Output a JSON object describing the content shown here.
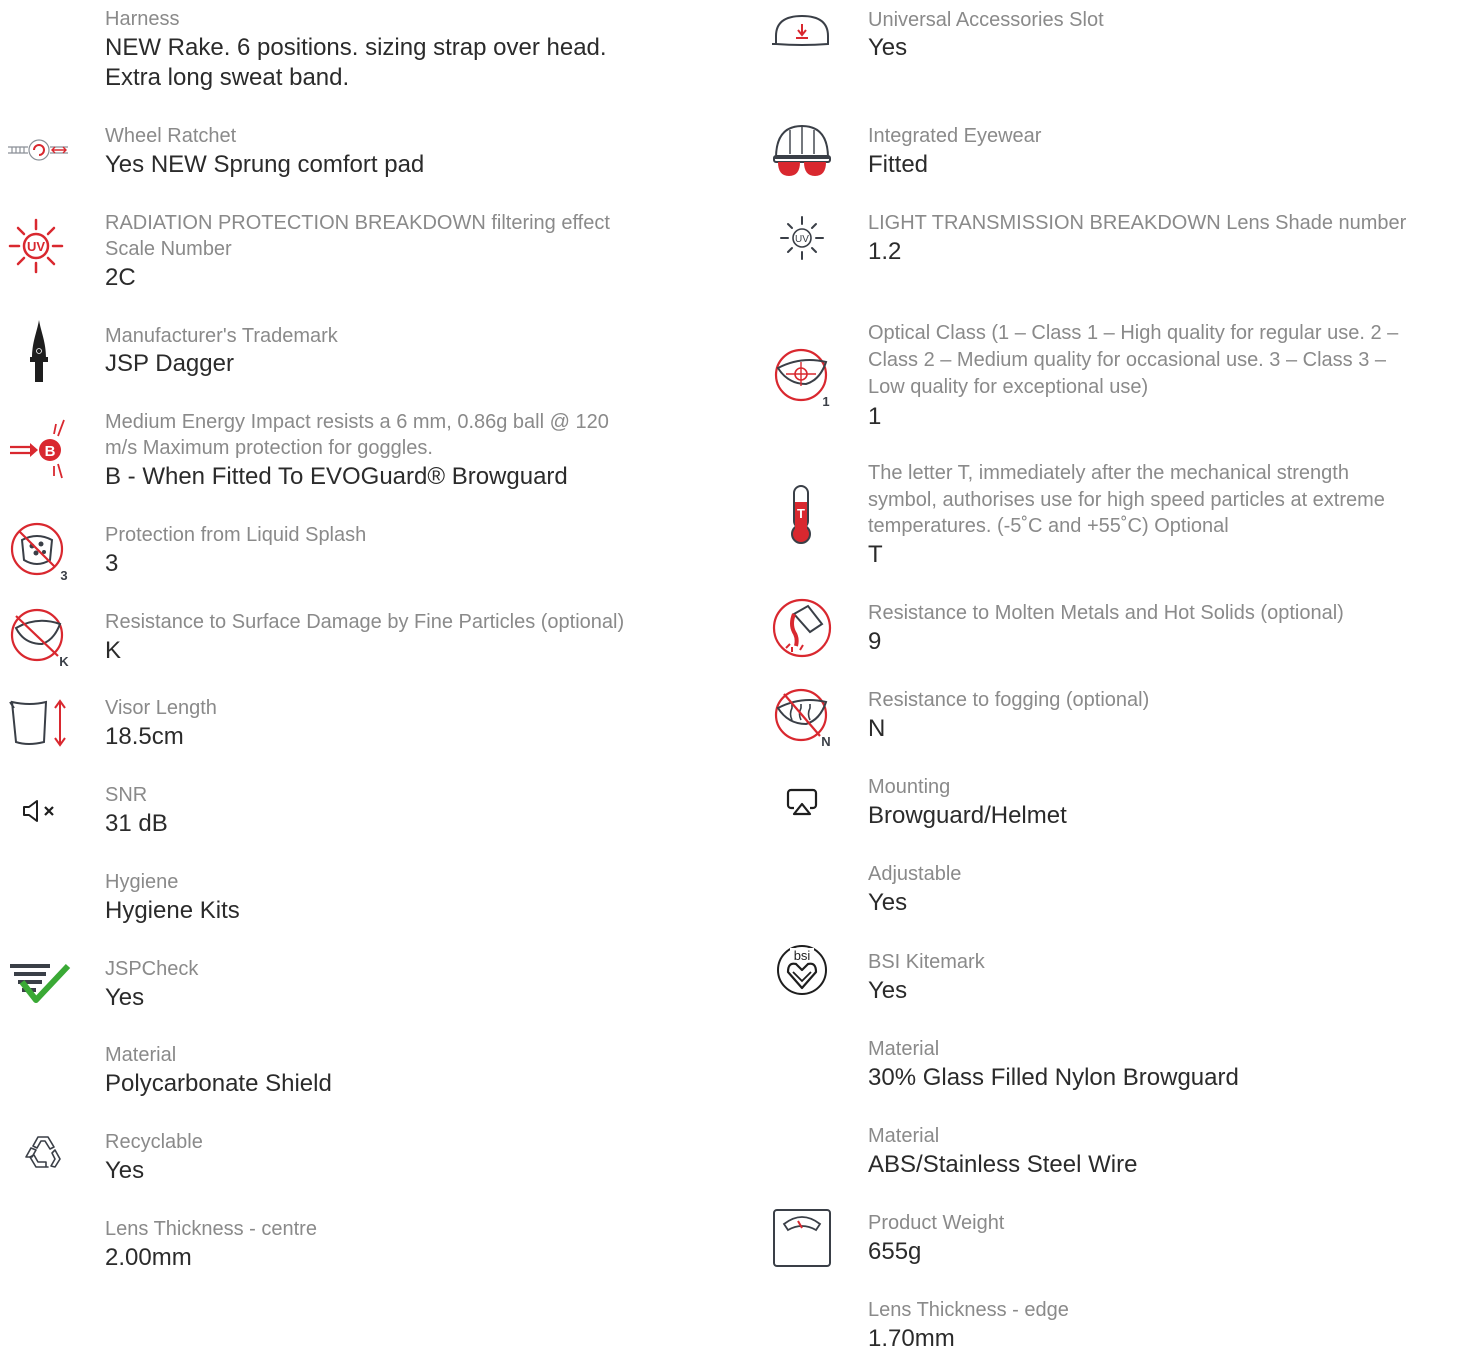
{
  "colors": {
    "accent_red": "#d9282f",
    "label_gray": "#8a8a8a",
    "value_dark": "#2b2b2b",
    "icon_dark": "#3a3f47",
    "check_green": "#3aa935"
  },
  "left": [
    {
      "icon": "none",
      "label": "Harness",
      "value_lines": [
        "NEW Rake. 6 positions. sizing strap over head.",
        "Extra long sweat band."
      ]
    },
    {
      "icon": "wheel-ratchet-icon",
      "label": "Wheel Ratchet",
      "value": "Yes NEW Sprung comfort pad"
    },
    {
      "icon": "uv-radiation-icon",
      "label_lines": [
        "RADIATION PROTECTION BREAKDOWN filtering effect",
        "Scale Number"
      ],
      "value": "2C"
    },
    {
      "icon": "dagger-trademark-icon",
      "label": "Manufacturer's Trademark",
      "value": "JSP Dagger"
    },
    {
      "icon": "impact-b-icon",
      "label_lines": [
        "Medium Energy Impact resists a 6 mm, 0.86g ball @ 120",
        "m/s Maximum protection for goggles."
      ],
      "value": "B - When Fitted To EVOGuard® Browguard"
    },
    {
      "icon": "liquid-splash-icon",
      "label": "Protection from Liquid Splash",
      "value": "3"
    },
    {
      "icon": "surface-damage-icon",
      "label": "Resistance to Surface Damage by Fine Particles (optional)",
      "value": "K"
    },
    {
      "icon": "visor-length-icon",
      "label": "Visor Length",
      "value": "18.5cm"
    },
    {
      "icon": "speaker-mute-icon",
      "label": "SNR",
      "value": "31 dB"
    },
    {
      "icon": "none",
      "label": "Hygiene",
      "value": "Hygiene Kits"
    },
    {
      "icon": "jspcheck-icon",
      "label": "JSPCheck",
      "value": "Yes"
    },
    {
      "icon": "none",
      "label": "Material",
      "value": "Polycarbonate Shield"
    },
    {
      "icon": "recycle-icon",
      "label": "Recyclable",
      "value": "Yes"
    },
    {
      "icon": "none",
      "label": "Lens Thickness - centre",
      "value": "2.00mm"
    }
  ],
  "right": [
    {
      "icon": "accessory-slot-icon",
      "label": "Universal Accessories Slot",
      "value": "Yes"
    },
    {
      "icon": "integrated-eyewear-icon",
      "label": "Integrated Eyewear",
      "value": "Fitted"
    },
    {
      "icon": "uv-light-icon",
      "label": "LIGHT TRANSMISSION BREAKDOWN Lens Shade number",
      "value": "1.2"
    },
    {
      "icon": "optical-class-icon",
      "label_lines": [
        "Optical Class (1 – Class 1 – High quality for regular use. 2 –",
        "Class 2 – Medium quality for occasional use. 3 – Class 3 –",
        "Low quality for exceptional use)"
      ],
      "value": "1"
    },
    {
      "icon": "thermometer-t-icon",
      "label_lines": [
        "The letter T, immediately after the mechanical strength",
        "symbol, authorises use for high speed particles at extreme",
        "temperatures. (-5˚C and +55˚C) Optional"
      ],
      "value": "T"
    },
    {
      "icon": "molten-metal-icon",
      "label": "Resistance to Molten Metals and Hot Solids (optional)",
      "value": "9"
    },
    {
      "icon": "anti-fog-icon",
      "label": "Resistance to fogging (optional)",
      "value": "N"
    },
    {
      "icon": "mounting-icon",
      "label": "Mounting",
      "value": "Browguard/Helmet"
    },
    {
      "icon": "none",
      "label": "Adjustable",
      "value": "Yes"
    },
    {
      "icon": "bsi-kitemark-icon",
      "label": "BSI Kitemark",
      "value": "Yes",
      "icon_text": "bsi"
    },
    {
      "icon": "none",
      "label": "Material",
      "value": "30% Glass Filled Nylon Browguard"
    },
    {
      "icon": "none",
      "label": "Material",
      "value": "ABS/Stainless Steel Wire"
    },
    {
      "icon": "weighing-scale-icon",
      "label": "Product Weight",
      "value": "655g"
    },
    {
      "icon": "none",
      "label": "Lens Thickness - edge",
      "value": "1.70mm"
    }
  ]
}
